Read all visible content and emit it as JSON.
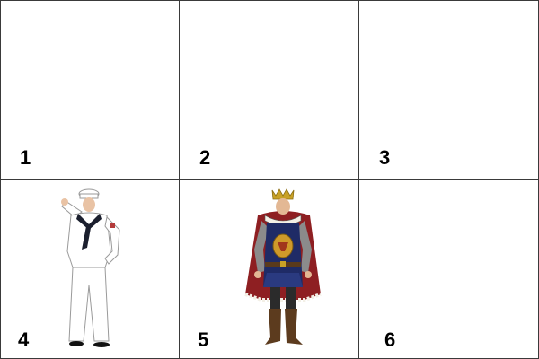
{
  "grid": {
    "rows": 2,
    "columns": 3,
    "line_color": "#3a3a3a",
    "cells": [
      {
        "number": "1",
        "content": "empty"
      },
      {
        "number": "2",
        "content": "empty"
      },
      {
        "number": "3",
        "content": "empty"
      },
      {
        "number": "4",
        "content": "sailor-costume"
      },
      {
        "number": "5",
        "content": "king-costume"
      },
      {
        "number": "6",
        "content": "empty"
      }
    ]
  }
}
